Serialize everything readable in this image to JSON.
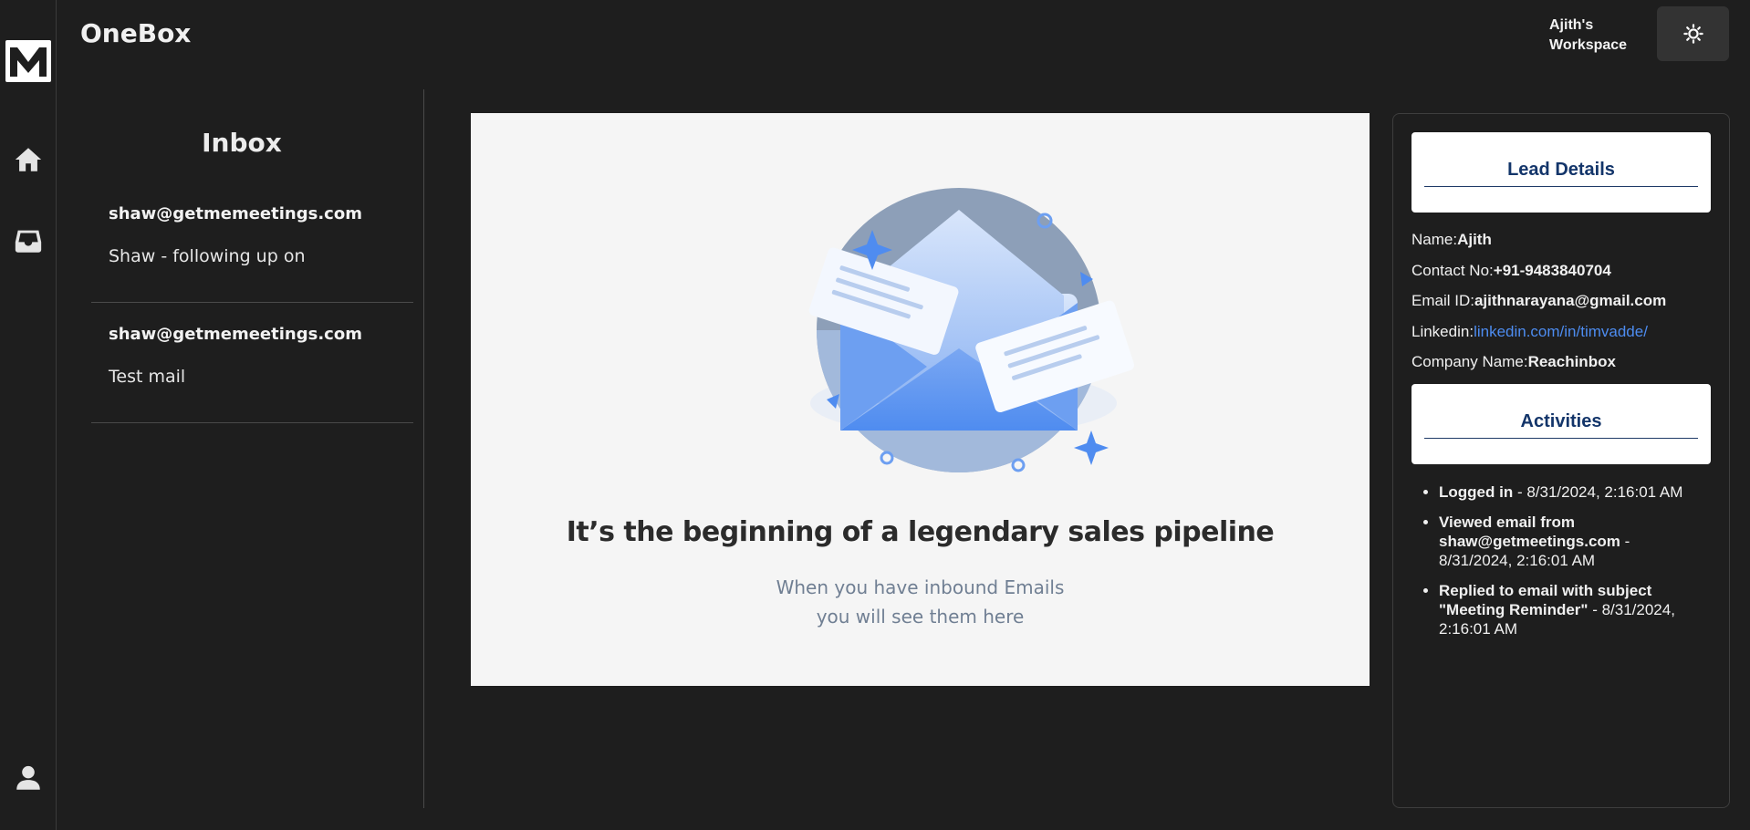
{
  "app": {
    "brand": "OneBox",
    "workspace_line1": "Ajith's",
    "workspace_line2": "Workspace"
  },
  "rail": {
    "icons": [
      "logo-m",
      "home-icon",
      "inbox-icon",
      "user-icon"
    ]
  },
  "header": {
    "theme_icon": "sun-icon"
  },
  "inbox": {
    "title": "Inbox",
    "items": [
      {
        "from": "shaw@getmemeetings.com",
        "subject": "Shaw - following up on"
      },
      {
        "from": "shaw@getmemeetings.com",
        "subject": "Test mail"
      }
    ]
  },
  "empty_state": {
    "title": "It’s the beginning of a legendary sales pipeline",
    "sub_line1": "When you have inbound Emails",
    "sub_line2": "you will see them here"
  },
  "lead": {
    "section_title": "Lead Details",
    "name_label": "Name:",
    "name": "Ajith",
    "contact_label": "Contact No:",
    "contact": "+91-9483840704",
    "email_label": "Email ID:",
    "email": "ajithnarayana@gmail.com",
    "linkedin_label": "Linkedin:",
    "linkedin": "linkedin.com/in/timvadde/",
    "company_label": "Company Name:",
    "company": "Reachinbox"
  },
  "activities": {
    "section_title": "Activities",
    "items": [
      {
        "action": "Logged in",
        "time": " - 8/31/2024, 2:16:01 AM"
      },
      {
        "action": "Viewed email from shaw@getmeetings.com",
        "time": " - 8/31/2024, 2:16:01 AM"
      },
      {
        "action": "Replied to email with subject \"Meeting Reminder\"",
        "time": " - 8/31/2024, 2:16:01 AM"
      }
    ]
  },
  "colors": {
    "background": "#1e1e1e",
    "panel": "#f5f5f5",
    "accent_blue": "#4d8cf0",
    "card_title": "#13356a"
  }
}
